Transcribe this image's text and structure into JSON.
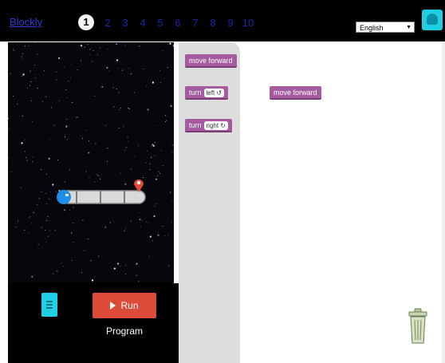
{
  "header": {
    "brand": "Blockly",
    "current_level": "1",
    "levels": [
      "2",
      "3",
      "4",
      "5",
      "6",
      "7",
      "8",
      "9",
      "10"
    ],
    "language": "English",
    "colors": {
      "level_link": "#1c25a8",
      "accent": "#1ed0e6"
    }
  },
  "controls": {
    "run_label": "Run Program",
    "run_color": "#dd4b39"
  },
  "toolbox": {
    "move_forward": "move forward",
    "turn_left_prefix": "turn",
    "turn_left_option": "left ↺",
    "turn_right_prefix": "turn",
    "turn_right_option": "right ↻",
    "block_color": "#a55b9f"
  },
  "workspace": {
    "block_label": "move forward"
  }
}
